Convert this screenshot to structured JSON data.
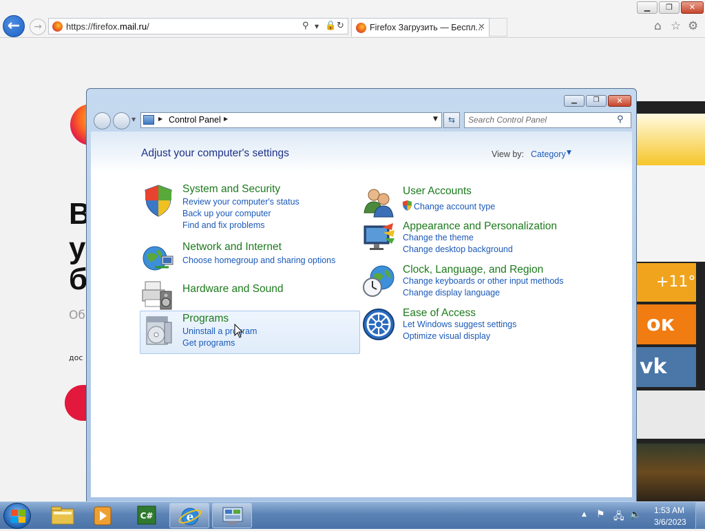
{
  "browser": {
    "url_prefix": "https://firefox.",
    "url_domain": "mail.ru",
    "url_suffix": "/",
    "tab_title": "Firefox Загрузить — Беспл...",
    "tab_close": "✕",
    "back_glyph": "←",
    "forward_glyph": "→",
    "controls": {
      "minimize": "▁",
      "maximize": "❐",
      "close": "✕"
    },
    "toolbar_icons": [
      "home-icon",
      "star-icon",
      "gear-icon"
    ]
  },
  "background_page": {
    "headline_letters": [
      "В",
      "у",
      "б"
    ],
    "subtitle_fragment": "Об",
    "small_text_fragment": "дос",
    "tiles": {
      "weather": "+11°",
      "ok_glyph": "ок",
      "vk_glyph": "vk"
    }
  },
  "control_panel": {
    "address": {
      "location": "Control Panel"
    },
    "search": {
      "placeholder": "Search Control Panel"
    },
    "heading": "Adjust your computer's settings",
    "view_by": {
      "label": "View by:",
      "value": "Category"
    },
    "categories_left": [
      {
        "title": "System and Security",
        "icon": "shield-icon",
        "links": [
          "Review your computer's status",
          "Back up your computer",
          "Find and fix problems"
        ]
      },
      {
        "title": "Network and Internet",
        "icon": "globe-network-icon",
        "links": [
          "Choose homegroup and sharing options"
        ]
      },
      {
        "title": "Hardware and Sound",
        "icon": "printer-speaker-icon",
        "links": []
      },
      {
        "title": "Programs",
        "icon": "programs-disc-icon",
        "links": [
          "Uninstall a program",
          "Get programs"
        ]
      }
    ],
    "categories_right": [
      {
        "title": "User Accounts",
        "icon": "users-icon",
        "links": [
          "Change account type"
        ]
      },
      {
        "title": "Appearance and Personalization",
        "icon": "monitor-paint-icon",
        "links": [
          "Change the theme",
          "Change desktop background"
        ]
      },
      {
        "title": "Clock, Language, and Region",
        "icon": "clock-globe-icon",
        "links": [
          "Change keyboards or other input methods",
          "Change display language"
        ]
      },
      {
        "title": "Ease of Access",
        "icon": "ease-of-access-icon",
        "links": [
          "Let Windows suggest settings",
          "Optimize visual display"
        ]
      }
    ]
  },
  "taskbar": {
    "items": [
      "file-explorer-icon",
      "media-player-icon",
      "csharp-icon",
      "internet-explorer-icon",
      "control-panel-icon"
    ],
    "active_item": "control-panel-icon",
    "time": "1:53 AM",
    "date": "3/6/2023"
  },
  "colors": {
    "link": "#1a59b8",
    "category_title": "#1c7a1c",
    "heading": "#1e3287",
    "taskbar": "#5c83b5"
  }
}
